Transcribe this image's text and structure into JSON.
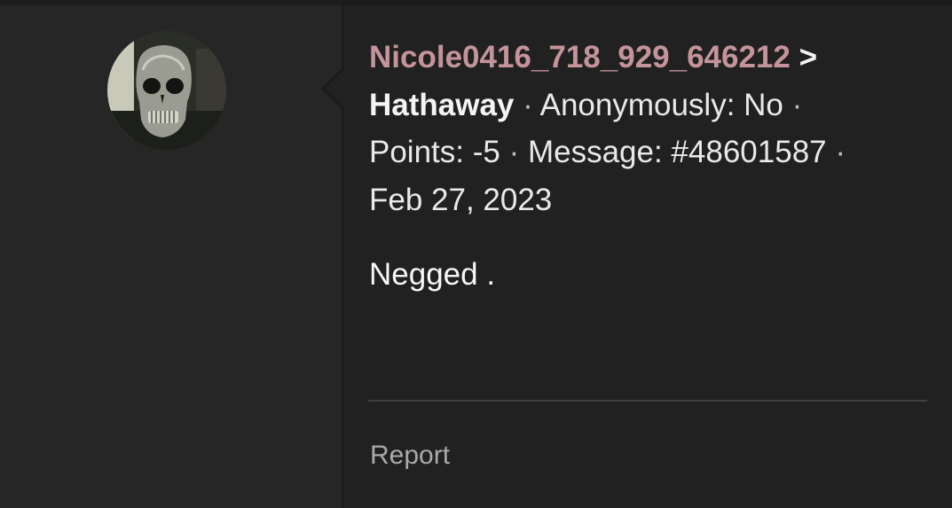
{
  "post": {
    "author": "Nicole0416_718_929_646212",
    "arrow": ">",
    "recipient": "Hathaway",
    "separator": " · ",
    "anonymously_label": "Anonymously: No",
    "points_label": "Points: -5",
    "message_label": "Message: #48601587",
    "date": "Feb 27, 2023",
    "body": "Negged ."
  },
  "actions": {
    "report_label": "Report"
  },
  "avatar": {
    "icon": "skull-balaclava-avatar"
  },
  "colors": {
    "background": "#212121",
    "sidebar": "#262626",
    "username": "#c4949a",
    "text": "#e9e9e9",
    "muted": "#a9a9a9"
  }
}
